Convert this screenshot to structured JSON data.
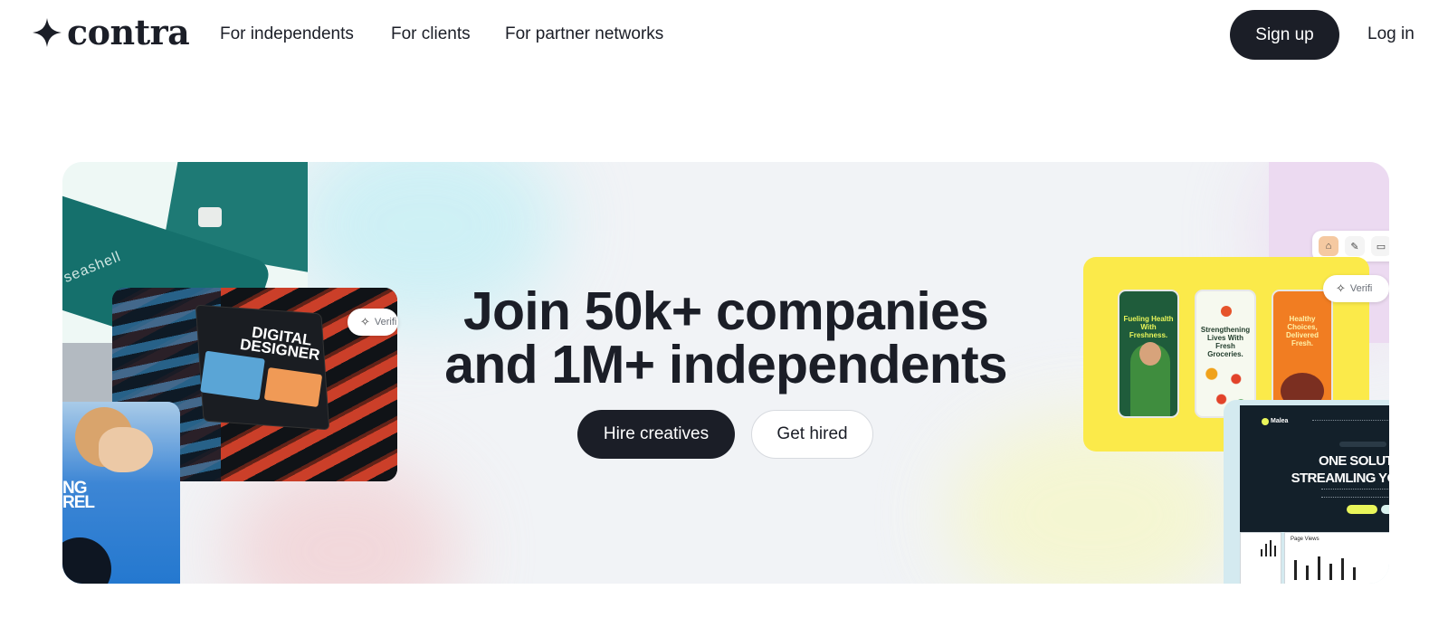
{
  "nav": {
    "logo_text": "contra",
    "links": [
      "For independents",
      "For clients",
      "For partner networks"
    ],
    "signup_label": "Sign up",
    "login_label": "Log in"
  },
  "hero": {
    "headline_line1": "Join 50k+ companies",
    "headline_line2": "and 1M+ independents",
    "hire_label": "Hire creatives",
    "get_hired_label": "Get hired"
  },
  "collage": {
    "card_brand": "seashell",
    "designer_title_line1": "DIGITAL",
    "designer_title_line2": "DESIGNER",
    "verified_label": "Verifi",
    "blue_card_text_line1": "NG",
    "blue_card_text_line2": "REL",
    "phone1_title": "Fueling Health With Freshness.",
    "phone2_title": "Strengthening Lives With Fresh Groceries.",
    "phone3_title": "Healthy Choices, Delivered Fresh.",
    "dark_card_brand": "Malea",
    "dark_card_headline_line1": "ONE SOLUTION",
    "dark_card_headline_line2": "STREAMLING YOUR",
    "page_views_label": "Page Views"
  },
  "colors": {
    "primary_dark": "#1b1e27",
    "hero_bg": "#f1f3f6",
    "yellow_card": "#fbea4a",
    "teal_card": "#15706c"
  },
  "icons": [
    "contra-star-icon",
    "sparkle-icon",
    "home-icon",
    "brush-icon",
    "inbox-icon"
  ]
}
